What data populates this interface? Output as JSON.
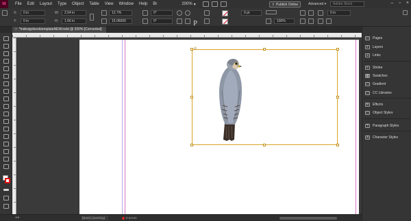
{
  "app": {
    "logo": "Id"
  },
  "menu": {
    "items": [
      "File",
      "Edit",
      "Layout",
      "Type",
      "Object",
      "Table",
      "View",
      "Window",
      "Help"
    ],
    "zoom": "200%",
    "publish_label": "Publish Online",
    "workspace": "Advanced",
    "stock_search_placeholder": "Adobe Stock"
  },
  "control_panel": {
    "x_label": "X:",
    "x_value": "0 in",
    "y_label": "Y:",
    "y_value": "0 in",
    "w_label": "W:",
    "w_value": "2.54 in",
    "h_label": "H:",
    "h_value": "1.66 in",
    "scale_x": "12.7%",
    "scale_y": "15.06000",
    "angle": "0°",
    "shear": "0°",
    "stroke_weight": "0 pt",
    "opacity": "100%",
    "offset": "0 in"
  },
  "tab": {
    "title": "*indesignbooktemplateNEW.indd @ 200% [Converted]",
    "close": "×"
  },
  "status": {
    "style_field": "[Basic] (working)",
    "preflight": "0 errors"
  },
  "panels": [
    {
      "icon": "pages-icon",
      "glyph": "▭",
      "label": "Pages"
    },
    {
      "icon": "layers-icon",
      "glyph": "≡",
      "label": "Layers"
    },
    {
      "icon": "links-icon",
      "glyph": "∞",
      "label": "Links"
    },
    {
      "icon": "stroke-icon",
      "glyph": "≡",
      "label": "Stroke"
    },
    {
      "icon": "swatches-icon",
      "glyph": "▦",
      "label": "Swatches"
    },
    {
      "icon": "gradient-icon",
      "glyph": "▭",
      "label": "Gradient"
    },
    {
      "icon": "cc-libraries-icon",
      "glyph": "▭",
      "label": "CC Libraries"
    },
    {
      "icon": "effects-icon",
      "glyph": "fx",
      "label": "Effects"
    },
    {
      "icon": "object-styles-icon",
      "glyph": "▭",
      "label": "Object Styles"
    },
    {
      "icon": "paragraph-styles-icon",
      "glyph": "¶",
      "label": "Paragraph Styles"
    },
    {
      "icon": "character-styles-icon",
      "glyph": "A",
      "label": "Character Styles"
    }
  ],
  "image": {
    "subject": "bird-photo"
  }
}
